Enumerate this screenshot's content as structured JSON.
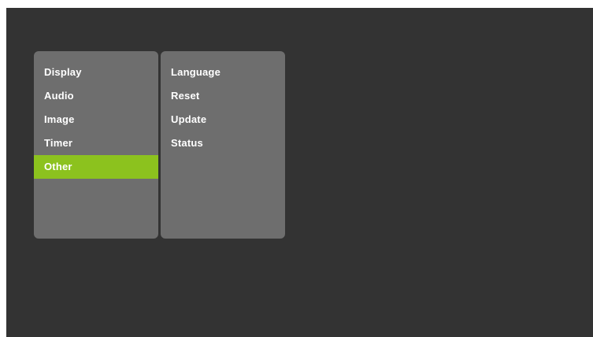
{
  "settings_menu": {
    "categories": [
      {
        "label": "Display"
      },
      {
        "label": "Audio"
      },
      {
        "label": "Image"
      },
      {
        "label": "Timer"
      },
      {
        "label": "Other",
        "selected": true
      }
    ],
    "selected_category": "Other",
    "submenu_items": [
      {
        "label": "Language"
      },
      {
        "label": "Reset"
      },
      {
        "label": "Update"
      },
      {
        "label": "Status"
      }
    ]
  },
  "colors": {
    "screen_background": "#333333",
    "panel_background": "#6e6e6e",
    "selection_accent": "#8cc21e",
    "text": "#ffffff"
  }
}
